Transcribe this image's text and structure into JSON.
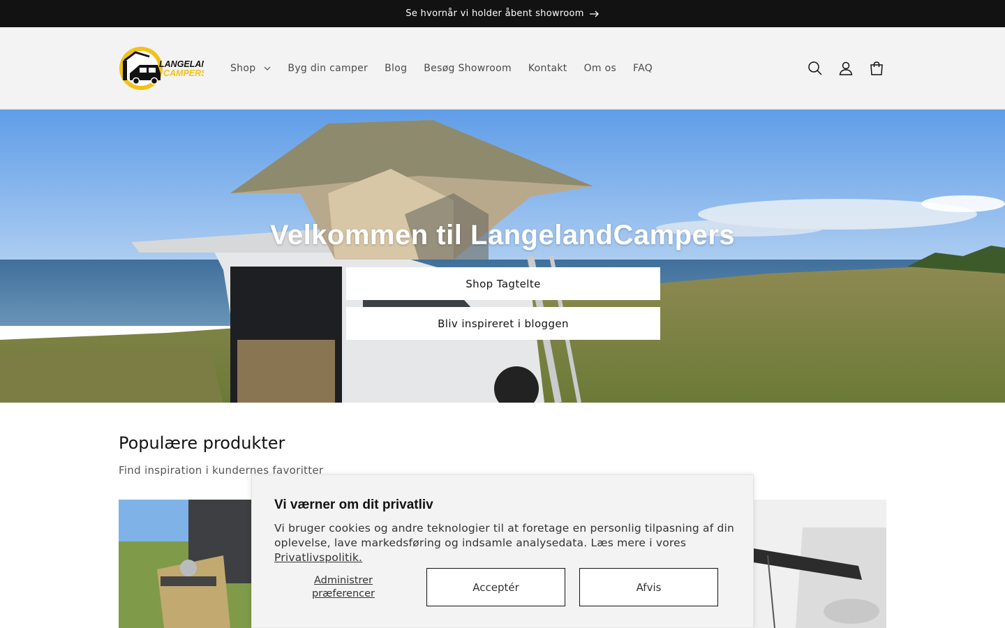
{
  "announcement": {
    "text": "Se hvornår vi holder åbent showroom"
  },
  "header": {
    "logo": {
      "line1": "LANGELAND",
      "line2": "CAMPERS"
    },
    "nav": [
      {
        "label": "Shop"
      },
      {
        "label": "Byg din camper"
      },
      {
        "label": "Blog"
      },
      {
        "label": "Besøg Showroom"
      },
      {
        "label": "Kontakt"
      },
      {
        "label": "Om os"
      },
      {
        "label": "FAQ"
      }
    ],
    "icons": [
      "search-icon",
      "account-icon",
      "cart-icon"
    ]
  },
  "hero": {
    "title": "Velkommen til LangelandCampers",
    "button_primary": "Shop Tagtelte",
    "button_secondary": "Bliv inspireret i bloggen"
  },
  "popular": {
    "title": "Populære produkter",
    "subtitle": "Find inspiration i kundernes favoritter"
  },
  "cookie": {
    "title": "Vi værner om dit privatliv",
    "text": "Vi bruger cookies og andre teknologier til at foretage en personlig tilpasning af din oplevelse, lave markedsføring og indsamle analysedata. Læs mere i vores ",
    "link": "Privatlivspolitik.",
    "manage": "Administrer præferencer",
    "accept": "Acceptér",
    "decline": "Afvis"
  },
  "colors": {
    "announcement_bg": "#121212",
    "header_bg": "#f3f3f3",
    "logo_yellow": "#f2c21b",
    "text": "#121212"
  }
}
